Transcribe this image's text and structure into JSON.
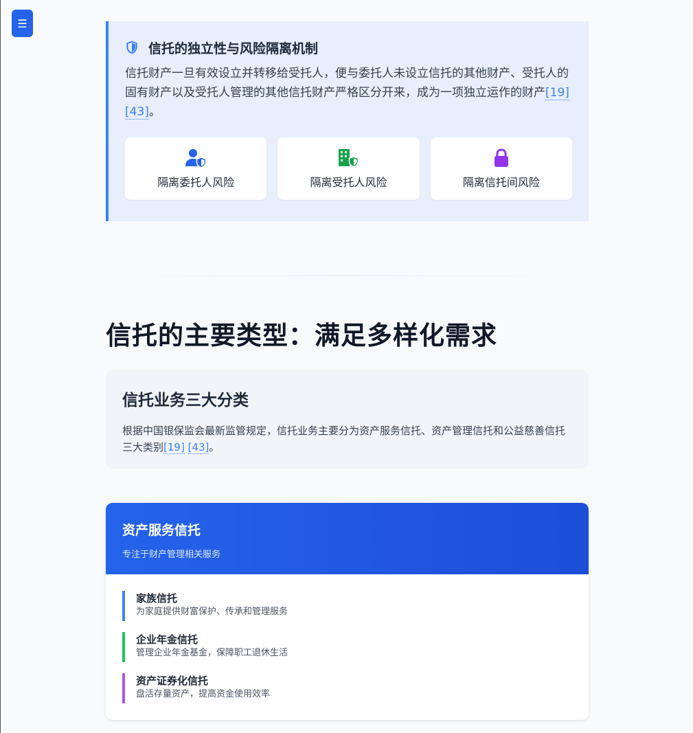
{
  "menu": {
    "icon": "menu-icon",
    "glyph": "☰"
  },
  "callout": {
    "title": "信托的独立性与风险隔离机制",
    "body_text": "信托财产一旦有效设立并转移给受托人，便与委托人未设立信托的其他财产、受托人的固有财产以及受托人管理的其他信托财产严格区分开来，成为一项独立运作的财产",
    "citations": [
      "[19]",
      "[43]"
    ],
    "body_end": "。",
    "cards": [
      {
        "label": "隔离委托人风险",
        "icon": "user-shield-icon",
        "color": "#2563eb"
      },
      {
        "label": "隔离受托人风险",
        "icon": "building-shield-icon",
        "color": "#16a34a"
      },
      {
        "label": "隔离信托间风险",
        "icon": "lock-icon",
        "color": "#9333ea"
      }
    ]
  },
  "section": {
    "title": "信托的主要类型：满足多样化需求"
  },
  "info": {
    "title": "信托业务三大分类",
    "body_text": "根据中国银保监会最新监管规定，信托业务主要分为资产服务信托、资产管理信托和公益慈善信托三大类别",
    "citations": [
      "[19]",
      "[43]"
    ],
    "body_end": "。"
  },
  "panel": {
    "title": "资产服务信托",
    "subtitle": "专注于财产管理相关服务",
    "items": [
      {
        "title": "家族信托",
        "desc": "为家庭提供财富保护、传承和管理服务",
        "color": "#3b82f6"
      },
      {
        "title": "企业年金信托",
        "desc": "管理企业年金基金，保障职工退休生活",
        "color": "#22c55e"
      },
      {
        "title": "资产证券化信托",
        "desc": "盘活存量资产，提高资金使用效率",
        "color": "#a855f7"
      }
    ]
  }
}
